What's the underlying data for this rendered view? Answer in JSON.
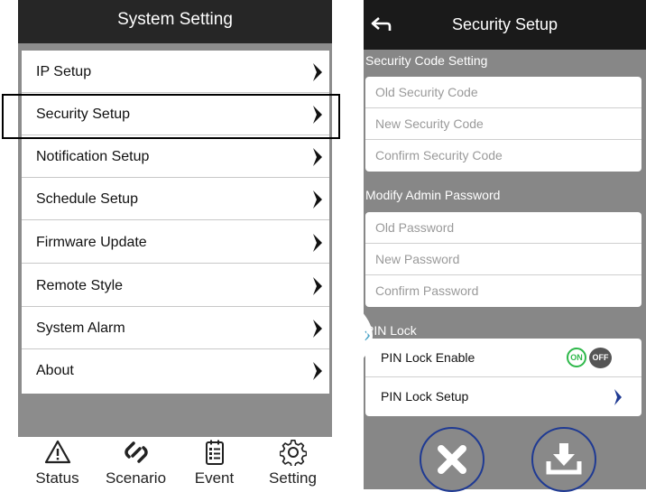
{
  "left": {
    "title": "System Setting",
    "menu": [
      {
        "label": "IP Setup"
      },
      {
        "label": "Security Setup"
      },
      {
        "label": "Notification Setup"
      },
      {
        "label": "Schedule Setup"
      },
      {
        "label": "Firmware Update"
      },
      {
        "label": "Remote Style"
      },
      {
        "label": "System Alarm"
      },
      {
        "label": "About"
      }
    ],
    "tabs": [
      {
        "label": "Status",
        "icon": "warning-icon"
      },
      {
        "label": "Scenario",
        "icon": "link-icon"
      },
      {
        "label": "Event",
        "icon": "event-list-icon"
      },
      {
        "label": "Setting",
        "icon": "gear-icon"
      }
    ]
  },
  "right": {
    "title": "Security Setup",
    "security_code": {
      "heading": "Security Code Setting",
      "old_placeholder": "Old Security Code",
      "new_placeholder": "New Security Code",
      "confirm_placeholder": "Confirm Security Code"
    },
    "admin_password": {
      "heading": "Modify Admin Password",
      "old_placeholder": "Old Password",
      "new_placeholder": "New Password",
      "confirm_placeholder": "Confirm Password"
    },
    "pin_lock": {
      "heading": "PIN Lock",
      "enable_label": "PIN Lock Enable",
      "toggle_on": "ON",
      "toggle_off": "OFF",
      "setup_label": "PIN Lock Setup"
    }
  },
  "colors": {
    "header_bg": "#262626",
    "list_frame_bg": "#8c8c8c",
    "accent_blue": "#1f3a93",
    "toggle_on_green": "#2eb84a"
  }
}
